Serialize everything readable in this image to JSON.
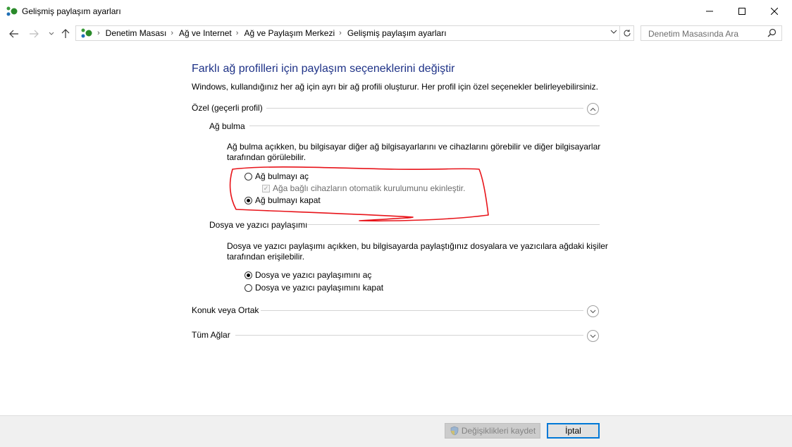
{
  "window": {
    "title": "Gelişmiş paylaşım ayarları"
  },
  "navigation": {
    "breadcrumbs": [
      "Denetim Masası",
      "Ağ ve Internet",
      "Ağ ve Paylaşım Merkezi",
      "Gelişmiş paylaşım ayarları"
    ],
    "search_placeholder": "Denetim Masasında Ara"
  },
  "page": {
    "heading": "Farklı ağ profilleri için paylaşım seçeneklerini değiştir",
    "description": "Windows, kullandığınız her ağ için ayrı bir ağ profili oluşturur. Her profil için özel seçenekler belirleyebilirsiniz."
  },
  "profiles": [
    {
      "label": "Özel (geçerli profil)",
      "expanded": true
    },
    {
      "label": "Konuk veya Ortak",
      "expanded": false
    },
    {
      "label": "Tüm Ağlar",
      "expanded": false
    }
  ],
  "network_discovery": {
    "title": "Ağ bulma",
    "description_line1": "Ağ bulma açıkken, bu bilgisayar diğer ağ bilgisayarlarını ve cihazlarını görebilir ve diğer bilgisayarlar",
    "description_line2": "tarafından görülebilir.",
    "option_on": "Ağ bulmayı aç",
    "auto_setup": "Ağa bağlı cihazların otomatik kurulumunu ekinleştir.",
    "option_off": "Ağ bulmayı kapat",
    "selected": "off"
  },
  "file_sharing": {
    "title": "Dosya ve yazıcı paylaşımı",
    "description_line1": "Dosya ve yazıcı paylaşımı açıkken, bu bilgisayarda paylaştığınız dosyalara ve yazıcılara ağdaki kişiler",
    "description_line2": "tarafından erişilebilir.",
    "option_on": "Dosya ve yazıcı paylaşımını aç",
    "option_off": "Dosya ve yazıcı paylaşımını kapat",
    "selected": "on"
  },
  "footer": {
    "save_label": "Değişiklikleri kaydet",
    "cancel_label": "İptal"
  },
  "colors": {
    "heading": "#1e3287",
    "annotation": "#e8141a",
    "accent": "#0078d7"
  }
}
